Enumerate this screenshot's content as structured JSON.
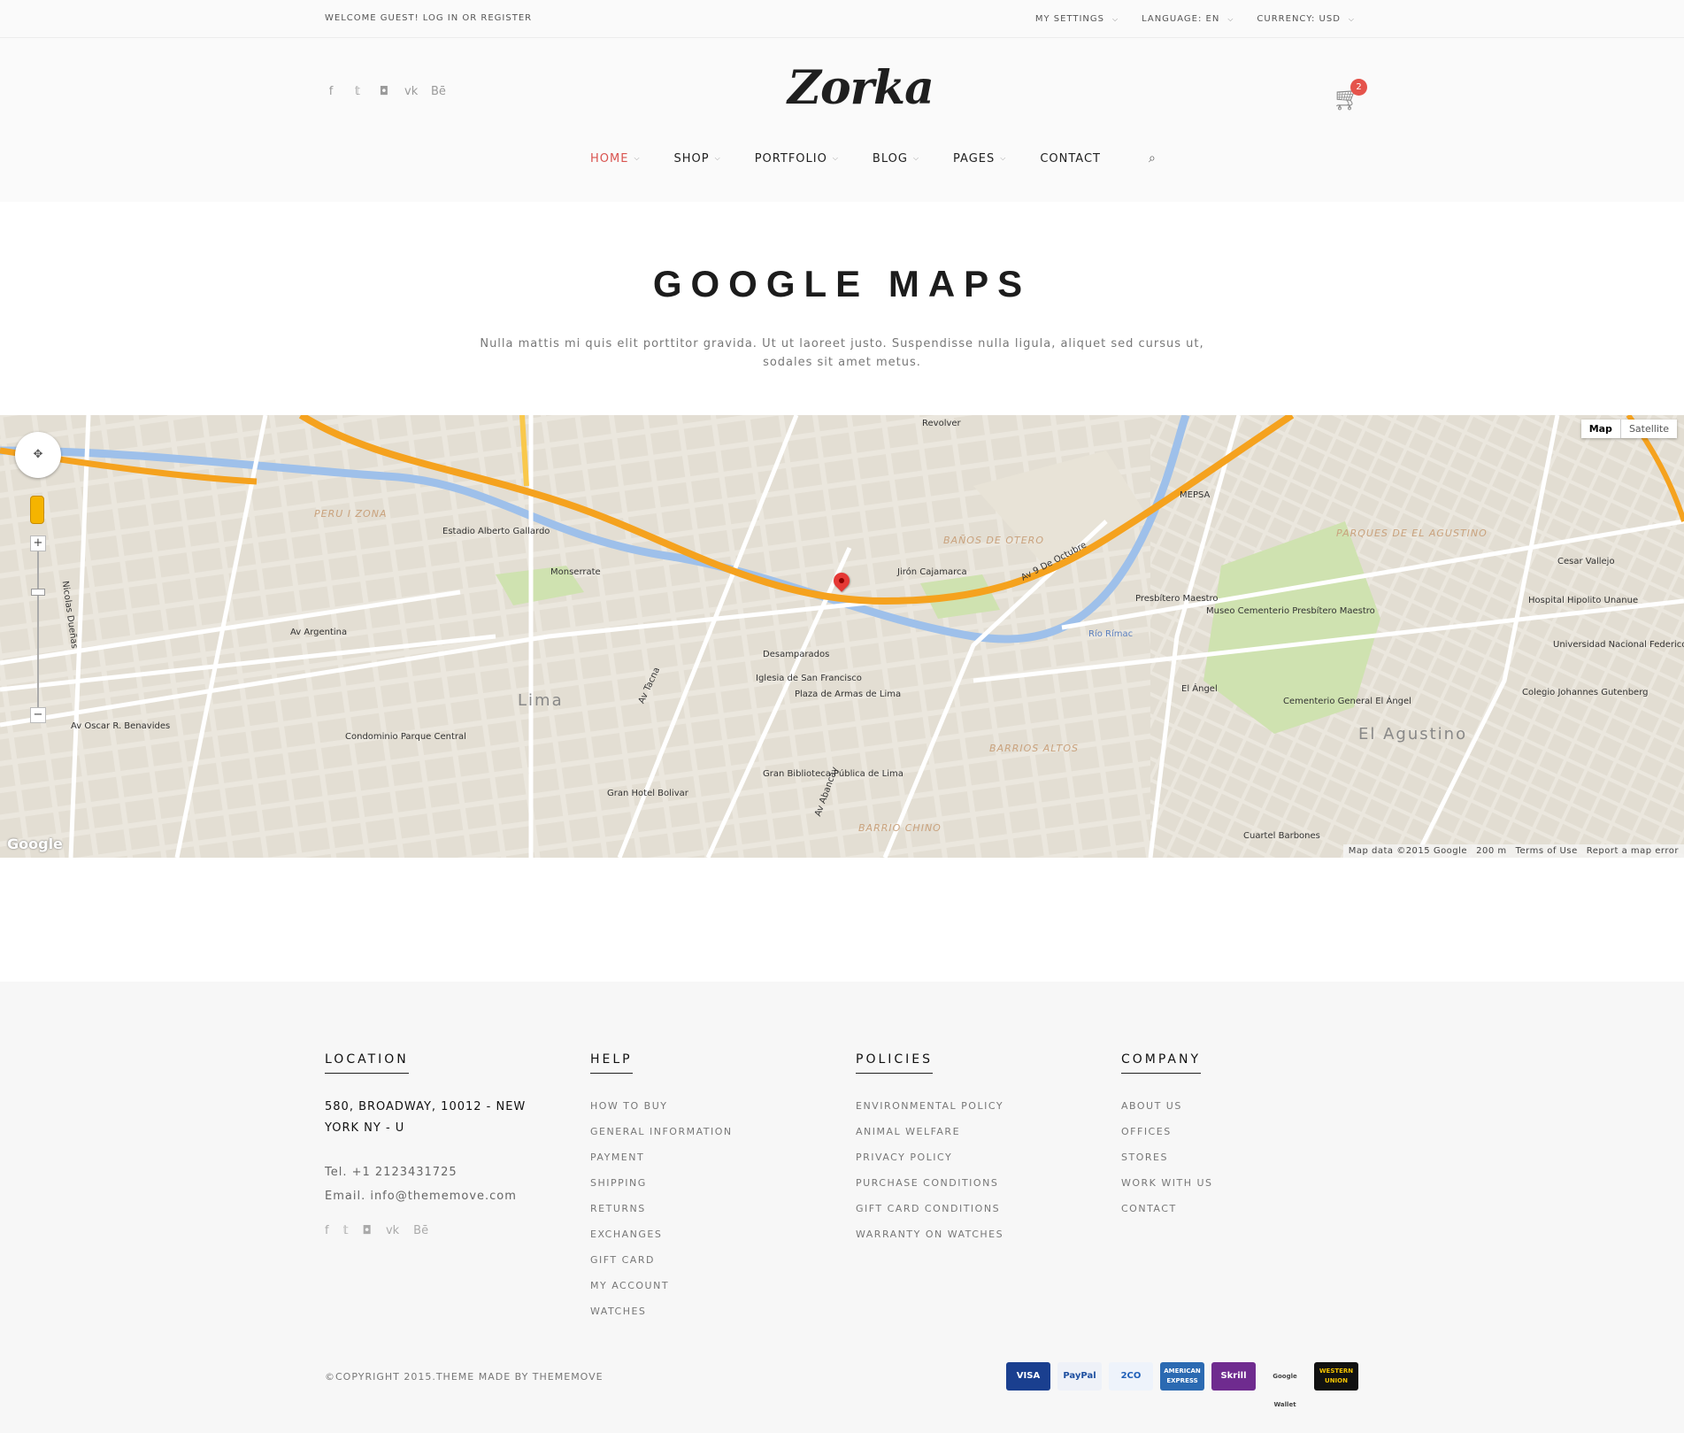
{
  "topbar": {
    "welcome": "WELCOME GUEST! LOG IN OR REGISTER",
    "my_settings": "MY SETTINGS",
    "language": "LANGUAGE: EN",
    "currency": "CURRENCY: USD"
  },
  "header": {
    "logo": "Zorka",
    "cart_count": "2",
    "social_icons": [
      "facebook-icon",
      "twitter-icon",
      "instagram-icon",
      "vk-icon",
      "behance-icon"
    ]
  },
  "nav": {
    "items": [
      {
        "label": "HOME",
        "active": true,
        "has_dropdown": true
      },
      {
        "label": "SHOP",
        "active": false,
        "has_dropdown": true
      },
      {
        "label": "PORTFOLIO",
        "active": false,
        "has_dropdown": true
      },
      {
        "label": "BLOG",
        "active": false,
        "has_dropdown": true
      },
      {
        "label": "PAGES",
        "active": false,
        "has_dropdown": true
      },
      {
        "label": "CONTACT",
        "active": false,
        "has_dropdown": false
      }
    ]
  },
  "page": {
    "title": "GOOGLE MAPS",
    "description": "Nulla mattis mi quis elit porttitor gravida. Ut ut laoreet justo. Suspendisse nulla ligula, aliquet sed cursus ut, sodales sit amet metus."
  },
  "map": {
    "type_map": "Map",
    "type_satellite": "Satellite",
    "google_logo": "Google",
    "attribution": "Map data ©2015 Google",
    "scale": "200 m",
    "terms": "Terms of Use",
    "report": "Report a map error",
    "labels": {
      "city": "Lima",
      "district_east": "El Agustino",
      "estadio": "Estadio Alberto Gallardo",
      "monserrate": "Monserrate",
      "desamparados": "Desamparados",
      "iglesia": "Iglesia de San Francisco",
      "plaza": "Plaza de Armas de Lima",
      "jiron_cajamarca": "Jirón Cajamarca",
      "av_argentina": "Av Argentina",
      "av_benavides": "Av Oscar R. Benavides",
      "rio_rimac": "Río Rímac",
      "presbitero": "Presbítero Maestro",
      "cementerio": "Cementerio General El Ángel",
      "hospital": "Hospital Hipolito Unanue",
      "universidad": "Universidad Nacional Federico Villarreal",
      "cesar_vallejo": "Cesar Vallejo",
      "mepsa": "MEPSA",
      "revolver": "Revolver",
      "barrios_altos": "BARRIOS ALTOS",
      "barrio_chino": "BARRIO CHINO",
      "gran_hotel": "Gran Hotel Bolivar",
      "biblioteca": "Gran Biblioteca Pública de Lima",
      "condominio": "Condominio Parque Central",
      "cuartel": "Cuartel Barbones",
      "el_angel": "El Ángel",
      "peru_zona": "PERU I ZONA",
      "baños_otero": "BAÑOS DE OTERO",
      "parques_agustino": "PARQUES DE EL AGUSTINO",
      "colegio": "Colegio Johannes Gutenberg",
      "museo": "Museo Cementerio Presbítero Maestro",
      "av_9_oct": "Av 9 De Octubre",
      "nicolas": "Nicolas Dueñas",
      "av_abancay": "Av Abancay",
      "av_tacna": "Av Tacna"
    }
  },
  "footer": {
    "location": {
      "heading": "LOCATION",
      "address": "580, BROADWAY, 10012 - NEW YORK NY - U",
      "tel": "Tel. +1 2123431725",
      "email": "Email. info@thememove.com"
    },
    "help": {
      "heading": "HELP",
      "links": [
        "HOW TO BUY",
        "GENERAL INFORMATION",
        "PAYMENT",
        "SHIPPING",
        "RETURNS",
        "EXCHANGES",
        "GIFT CARD",
        "MY ACCOUNT",
        "WATCHES"
      ]
    },
    "policies": {
      "heading": "POLICIES",
      "links": [
        "ENVIRONMENTAL POLICY",
        "ANIMAL WELFARE",
        "PRIVACY POLICY",
        "PURCHASE CONDITIONS",
        "GIFT CARD CONDITIONS",
        "WARRANTY ON WATCHES"
      ]
    },
    "company": {
      "heading": "COMPANY",
      "links": [
        "ABOUT US",
        "OFFICES",
        "STORES",
        "WORK WITH US",
        "CONTACT"
      ]
    },
    "copyright": "©COPYRIGHT 2015.THEME MADE BY THEMEMOVE",
    "payments": [
      {
        "label": "VISA",
        "bg": "#1a3f8f",
        "fg": "#ffffff"
      },
      {
        "label": "PayPal",
        "bg": "#eef1f8",
        "fg": "#1e4fa0"
      },
      {
        "label": "2CO",
        "bg": "#eef3fb",
        "fg": "#1f5fb8"
      },
      {
        "label": "AMERICAN EXPRESS",
        "bg": "#2b6ab2",
        "fg": "#ffffff"
      },
      {
        "label": "Skrill",
        "bg": "#6f2b8f",
        "fg": "#ffffff"
      },
      {
        "label": "Google Wallet",
        "bg": "#f7f7f7",
        "fg": "#444444"
      },
      {
        "label": "WESTERN UNION",
        "bg": "#111111",
        "fg": "#f5c400"
      }
    ]
  },
  "colors": {
    "accent": "#d9534f",
    "road_major": "#f5a21e",
    "river": "#8db4e4",
    "park": "#c9dfab"
  }
}
